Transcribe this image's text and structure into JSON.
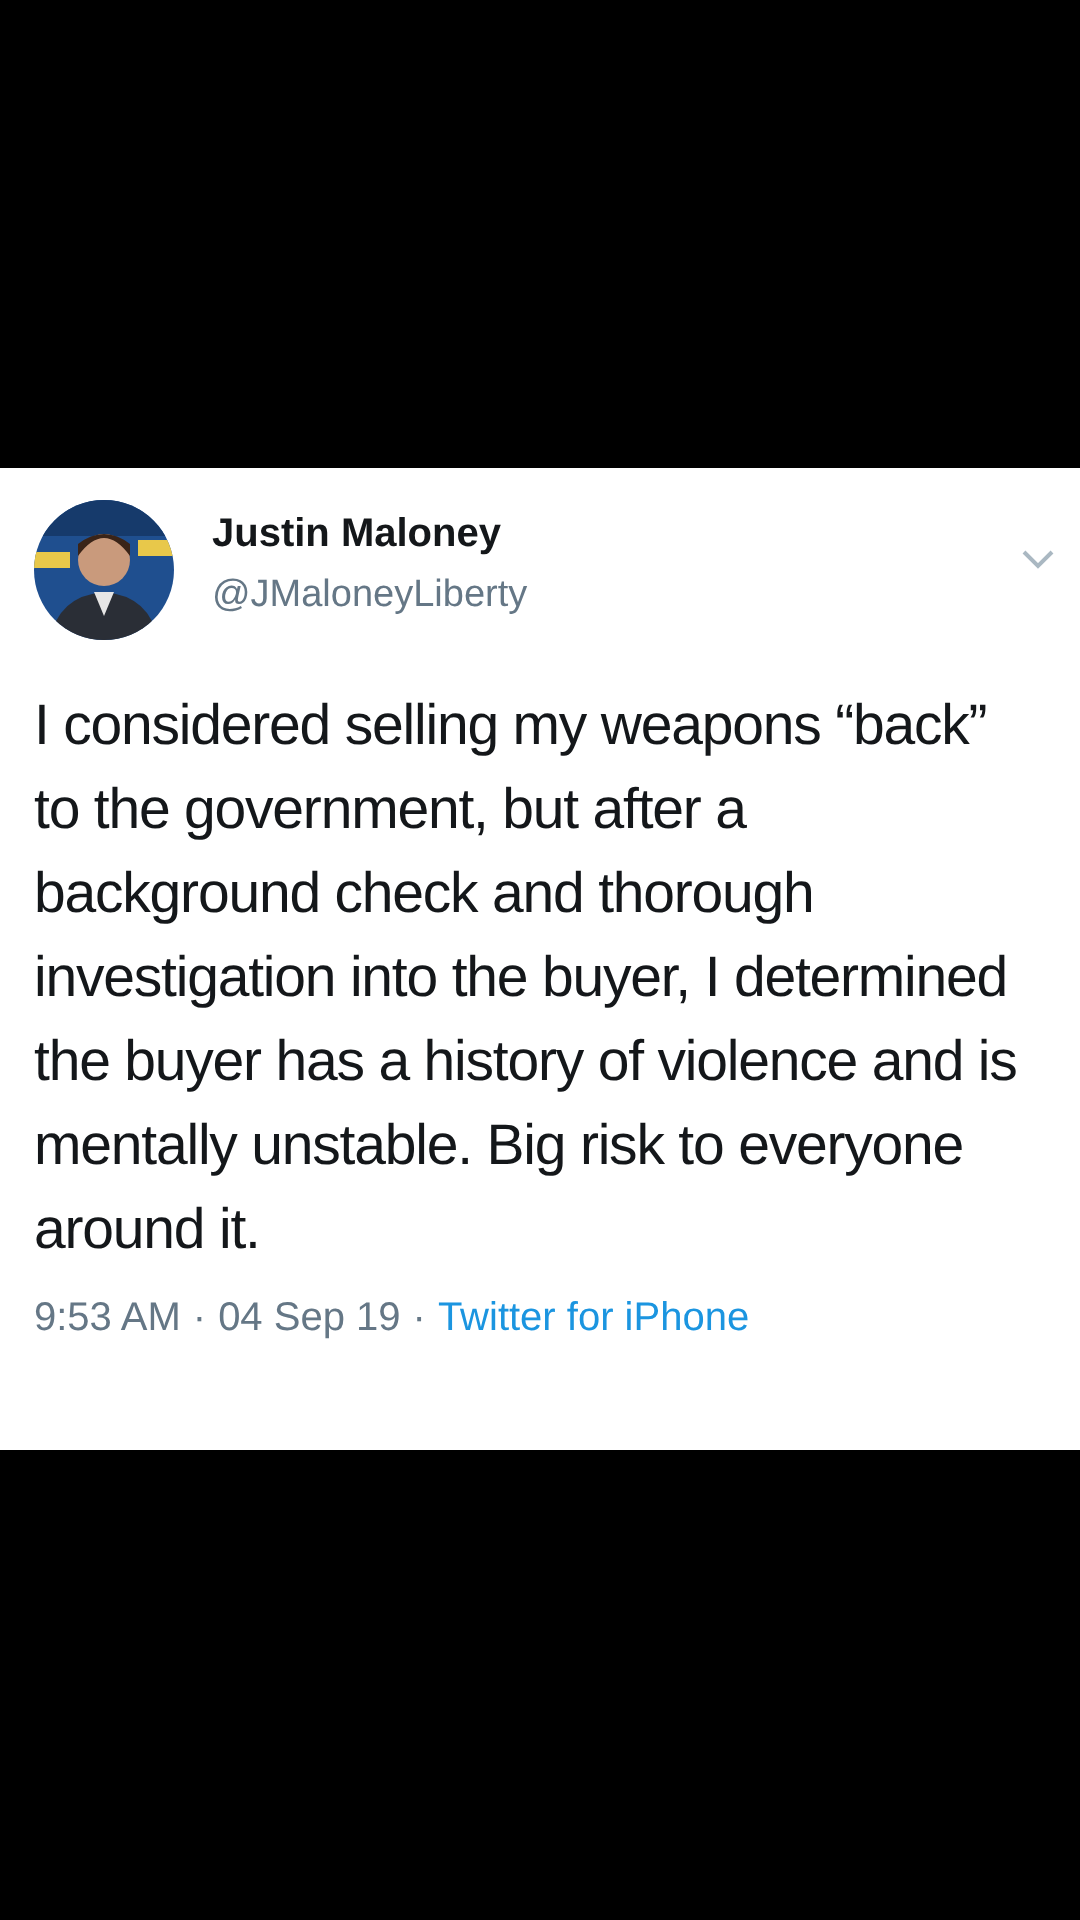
{
  "tweet": {
    "author": {
      "name": "Justin Maloney",
      "handle": "@JMaloneyLiberty"
    },
    "text": "I considered selling my weapons “back” to the government, but after a background check and thorough investigation into the buyer, I determined the buyer has a history of violence and is mentally unstable. Big risk to everyone around it.",
    "meta": [
      {
        "kind": "text",
        "text": "9:53 AM"
      },
      {
        "kind": "separator",
        "text": "·"
      },
      {
        "kind": "text",
        "text": "04 Sep 19"
      },
      {
        "kind": "separator",
        "text": "·"
      },
      {
        "kind": "link",
        "text": "Twitter for iPhone"
      }
    ]
  }
}
